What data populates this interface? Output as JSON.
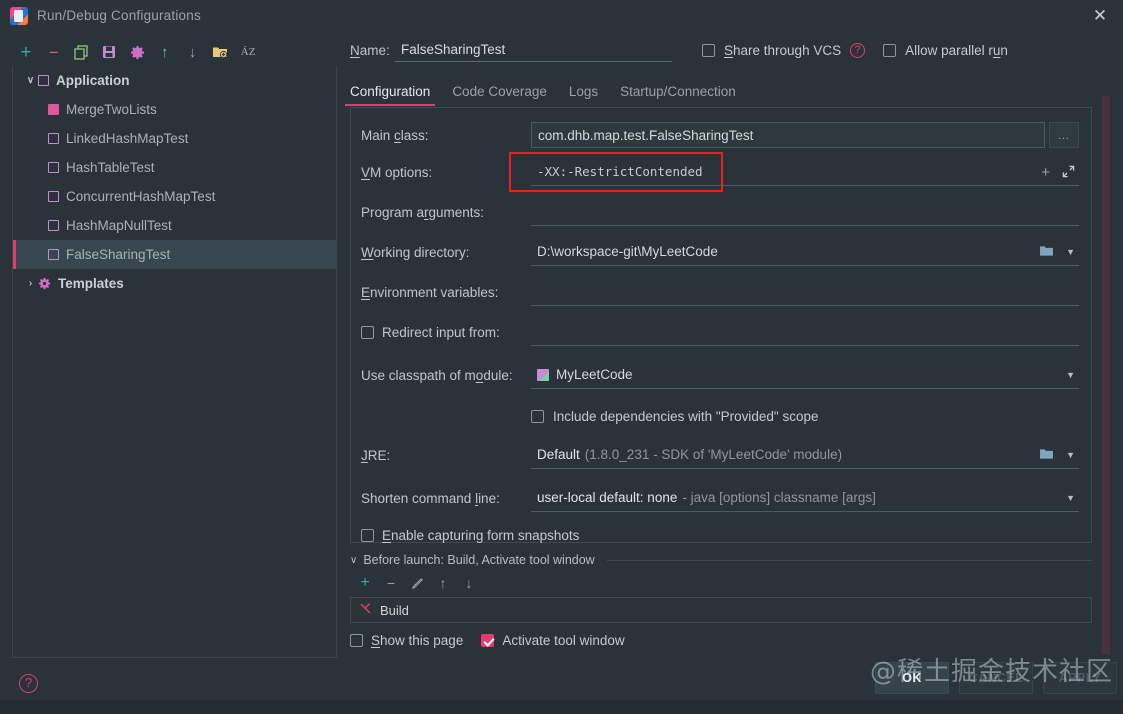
{
  "window": {
    "title": "Run/Debug Configurations",
    "close_label": "✕",
    "app_icon": "intellij-idea-icon"
  },
  "toolbar": {
    "items": [
      {
        "name": "add-configuration",
        "glyph": "+",
        "color": "#3aa6b0"
      },
      {
        "name": "remove-configuration",
        "glyph": "−",
        "color": "#cf6a6a"
      },
      {
        "name": "copy-configuration",
        "glyph": "❐",
        "color": "#8fc97a"
      },
      {
        "name": "save-configuration",
        "glyph": "💾",
        "color": "#c98ad4"
      },
      {
        "name": "edit-templates",
        "glyph": "⚙",
        "color": "#d06cc4"
      },
      {
        "name": "move-up",
        "glyph": "↑",
        "color": "#6ec39a"
      },
      {
        "name": "move-down",
        "glyph": "↓",
        "color": "#97a0a6"
      },
      {
        "name": "new-folder",
        "glyph": "🗀",
        "color": "#e0c070"
      },
      {
        "name": "sort-alphabetically",
        "glyph": "ÁZ",
        "color": "#aab3b8"
      }
    ]
  },
  "tree": {
    "root": {
      "label": "Application",
      "twisty": "∨"
    },
    "items": [
      {
        "label": "MergeTwoLists",
        "selected": false,
        "filled": true
      },
      {
        "label": "LinkedHashMapTest",
        "selected": false,
        "filled": false
      },
      {
        "label": "HashTableTest",
        "selected": false,
        "filled": false
      },
      {
        "label": "ConcurrentHashMapTest",
        "selected": false,
        "filled": false
      },
      {
        "label": "HashMapNullTest",
        "selected": false,
        "filled": false
      },
      {
        "label": "FalseSharingTest",
        "selected": true,
        "filled": false
      }
    ],
    "templates": {
      "label": "Templates",
      "twisty": "›"
    }
  },
  "header": {
    "name_label": "Name:",
    "name_value": "FalseSharingTest",
    "share_vcs_label": "Share through VCS",
    "share_vcs_checked": false,
    "help_glyph": "?",
    "allow_parallel_label": "Allow parallel run",
    "allow_parallel_checked": false
  },
  "tabs": [
    {
      "label": "Configuration",
      "active": true
    },
    {
      "label": "Code Coverage",
      "active": false
    },
    {
      "label": "Logs",
      "active": false
    },
    {
      "label": "Startup/Connection",
      "active": false
    }
  ],
  "fields": {
    "main_class": {
      "label": "Main class:",
      "value": "com.dhb.map.test.FalseSharingTest",
      "browse": "…"
    },
    "vm_options": {
      "label": "VM options:",
      "value": "-XX:-RestrictContended",
      "highlight_color": "#f11d1d"
    },
    "program_arguments": {
      "label": "Program arguments:",
      "value": ""
    },
    "working_directory": {
      "label": "Working directory:",
      "value": "D:\\workspace-git\\MyLeetCode"
    },
    "environment_variables": {
      "label": "Environment variables:",
      "value": "",
      "macro_glyph": "$"
    },
    "redirect_input": {
      "label": "Redirect input from:",
      "value": "",
      "checked": false
    },
    "use_classpath": {
      "label": "Use classpath of module:",
      "value": "MyLeetCode"
    },
    "include_provided": {
      "label": "Include dependencies with \"Provided\" scope",
      "checked": false
    },
    "jre": {
      "label": "JRE:",
      "value": "Default",
      "hint": "(1.8.0_231 - SDK of 'MyLeetCode' module)"
    },
    "shorten_command_line": {
      "label": "Shorten command line:",
      "value": "user-local default: none",
      "hint": "- java [options] classname [args]"
    },
    "enable_capturing": {
      "label": "Enable capturing form snapshots",
      "checked": false
    }
  },
  "before_launch": {
    "header": "Before launch: Build, Activate tool window",
    "twisty": "∨",
    "toolbar": [
      {
        "name": "add-task",
        "glyph": "+",
        "color": "#3aa6b0"
      },
      {
        "name": "remove-task",
        "glyph": "−",
        "color": "#97a0a6"
      },
      {
        "name": "edit-task",
        "glyph": "✎",
        "color": "#97a0a6"
      },
      {
        "name": "move-task-up",
        "glyph": "↑",
        "color": "#97a0a6"
      },
      {
        "name": "move-task-down",
        "glyph": "↓",
        "color": "#97a0a6"
      }
    ],
    "task": {
      "label": "Build",
      "icon": "hammer-icon"
    },
    "show_this_page": {
      "label": "Show this page",
      "checked": false
    },
    "activate_tool_window": {
      "label": "Activate tool window",
      "checked": true
    }
  },
  "footer": {
    "help_glyph": "?",
    "ok_label": "OK",
    "cancel_label": "CANCEL",
    "apply_label": "APPLY",
    "watermark": "@稀土掘金技术社区"
  },
  "colors": {
    "accent_pink": "#e8396e",
    "background": "#293339",
    "panel_border": "#3e4a50",
    "selection": "#374750",
    "highlight_red": "#f11d1d",
    "scrollbar": "#4a2f3d"
  }
}
